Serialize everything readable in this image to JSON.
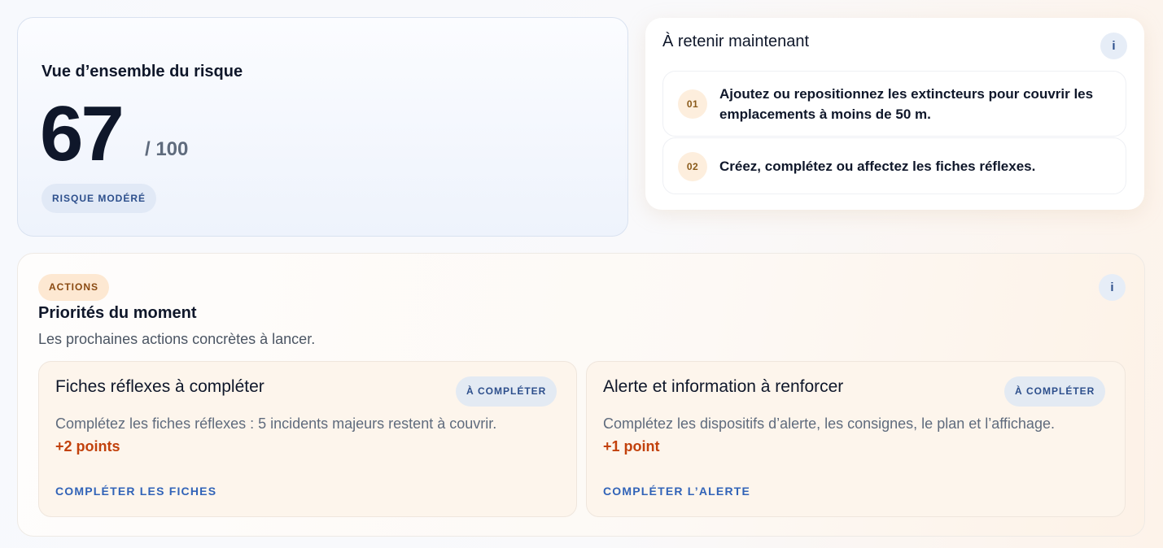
{
  "risk": {
    "title": "Vue d’ensemble du risque",
    "score": "67",
    "score_max": "/ 100",
    "level_badge": "RISQUE MODÉRÉ"
  },
  "retain": {
    "title": "À retenir maintenant",
    "info_label": "i",
    "items": [
      {
        "number": "01",
        "text": "Ajoutez ou repositionnez les extincteurs pour couvrir les emplacements à moins de 50 m."
      },
      {
        "number": "02",
        "text": "Créez, complétez ou affectez les fiches réflexes."
      }
    ]
  },
  "actions": {
    "badge": "ACTIONS",
    "title": "Priorités du moment",
    "subtitle": "Les prochaines actions concrètes à lancer.",
    "info_label": "i",
    "cards": [
      {
        "title": "Fiches réflexes à compléter",
        "status": "À COMPLÉTER",
        "description": "Complétez les fiches réflexes : 5 incidents majeurs restent à couvrir.",
        "points": "+2 points",
        "link": "COMPLÉTER LES FICHES"
      },
      {
        "title": "Alerte et information à renforcer",
        "status": "À COMPLÉTER",
        "description": "Complétez les dispositifs d’alerte, les consignes, le plan et l’affichage.",
        "points": "+1 point",
        "link": "COMPLÉTER L’ALERTE"
      }
    ]
  }
}
